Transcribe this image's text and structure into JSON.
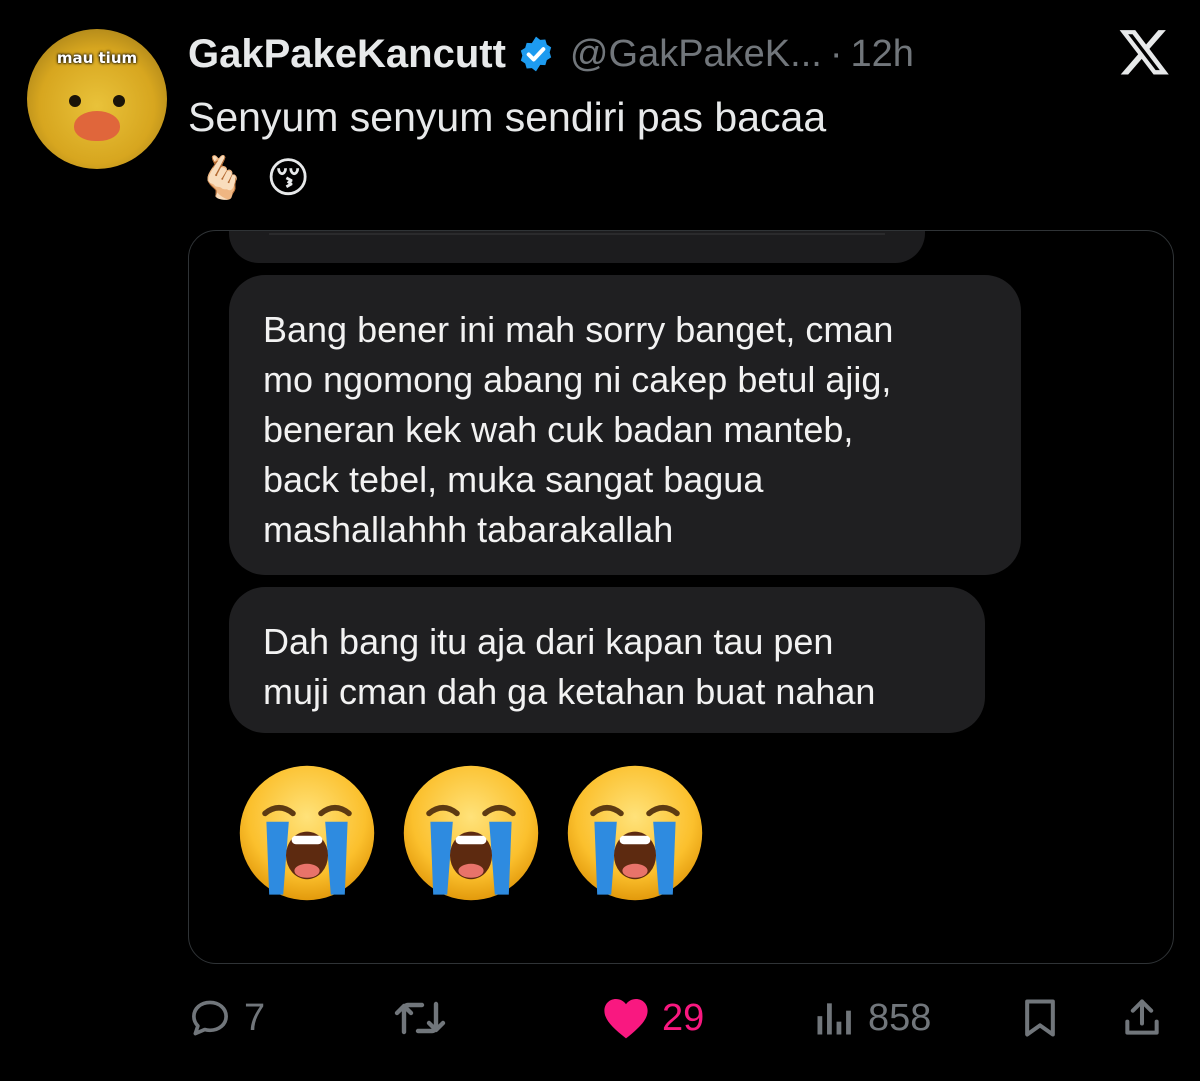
{
  "header": {
    "avatar_caption": "mau tium",
    "display_name": "GakPakeKancutt",
    "handle": "@GakPakeK...",
    "separator": "·",
    "time": "12h",
    "logo_icon": "x-logo-icon",
    "verified_icon": "verified-badge-icon"
  },
  "tweet": {
    "text": "Senyum senyum sendiri pas bacaa",
    "emojis": [
      "🫰🏻",
      "😚"
    ]
  },
  "media": {
    "messages": [
      "Bang bener ini mah sorry banget, cman\nmo ngomong abang ni cakep betul ajig,\nbeneran kek wah cuk badan manteb,\nback tebel, muka sangat bagua\nmashallahhh tabarakallah",
      "Dah bang itu aja dari kapan tau pen\nmuji cman dah ga ketahan buat nahan"
    ],
    "reaction_emojis": [
      "😭",
      "😭",
      "😭"
    ]
  },
  "actions": {
    "reply_count": "7",
    "retweet_count": "",
    "like_count": "29",
    "view_count": "858",
    "like_active": true
  },
  "colors": {
    "background": "#000000",
    "text": "#e7e9ea",
    "muted": "#71767b",
    "verified": "#1d9bf0",
    "like": "#f91880",
    "bubble": "#1f1f21"
  }
}
